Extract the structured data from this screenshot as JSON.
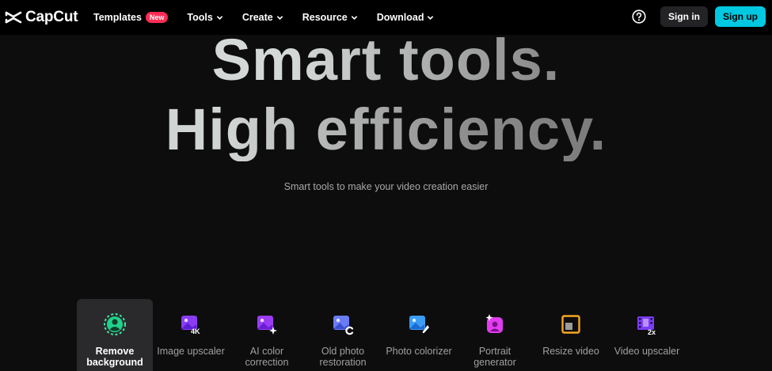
{
  "brand": {
    "name": "CapCut"
  },
  "nav": {
    "items": [
      {
        "label": "Templates",
        "badge": "New"
      },
      {
        "label": "Tools"
      },
      {
        "label": "Create"
      },
      {
        "label": "Resource"
      },
      {
        "label": "Download"
      }
    ],
    "help_icon": "question-circle-icon",
    "signin_label": "Sign in",
    "signup_label": "Sign up"
  },
  "hero": {
    "line1": "Smart tools.",
    "line2": "High efficiency.",
    "subtitle": "Smart tools to make your video creation easier"
  },
  "tools": [
    {
      "label": "Remove\nbackground",
      "icon": "remove-background-icon",
      "active": true
    },
    {
      "label": "Image upscaler",
      "icon": "image-upscaler-icon",
      "active": false
    },
    {
      "label": "AI color\ncorrection",
      "icon": "ai-color-correction-icon",
      "active": false
    },
    {
      "label": "Old photo\nrestoration",
      "icon": "old-photo-restoration-icon",
      "active": false
    },
    {
      "label": "Photo colorizer",
      "icon": "photo-colorizer-icon",
      "active": false
    },
    {
      "label": "Portrait\ngenerator",
      "icon": "portrait-generator-icon",
      "active": false
    },
    {
      "label": "Resize video",
      "icon": "resize-video-icon",
      "active": false
    },
    {
      "label": "Video upscaler",
      "icon": "video-upscaler-icon",
      "active": false
    }
  ],
  "colors": {
    "background": "#0d0d0e",
    "nav_background": "#000000",
    "signup": "#00c8e0",
    "badge": "#fe2c55",
    "active_tool": "#2a2a2c"
  }
}
